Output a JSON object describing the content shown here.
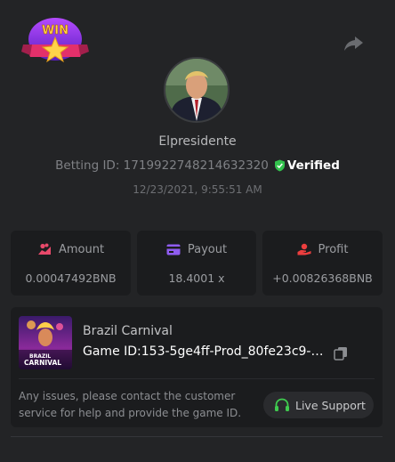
{
  "header": {
    "logo_text": "WIN",
    "share_icon": "share-icon"
  },
  "user": {
    "name": "Elpresidente",
    "betting_id_label": "Betting ID:",
    "betting_id": "1719922748214632320",
    "verified_label": "Verified",
    "timestamp": "12/23/2021, 9:55:51 AM"
  },
  "stats": {
    "amount": {
      "label": "Amount",
      "value": "0.00047492BNB",
      "icon": "coins-icon"
    },
    "payout": {
      "label": "Payout",
      "value": "18.4001 x",
      "icon": "card-icon"
    },
    "profit": {
      "label": "Profit",
      "value": "+0.00826368BNB",
      "icon": "hand-icon"
    }
  },
  "game": {
    "name": "Brazil Carnival",
    "id_label": "Game ID:",
    "id": "153-5ge4ff-Prod_80fe23c9-8...",
    "help_text": "Any issues, please contact the customer service for help and provide the game ID.",
    "support_label": "Live Support",
    "thumb_text_line1": "BRAZIL",
    "thumb_text_line2": "CARNIVAL"
  },
  "colors": {
    "background": "#232426",
    "card": "#1b1c1e",
    "verified_green": "#33c24d",
    "amount_icon": "#e8496a",
    "payout_icon": "#8f5cf0",
    "profit_icon": "#ec3e3e",
    "support_icon": "#3fcb4f"
  }
}
